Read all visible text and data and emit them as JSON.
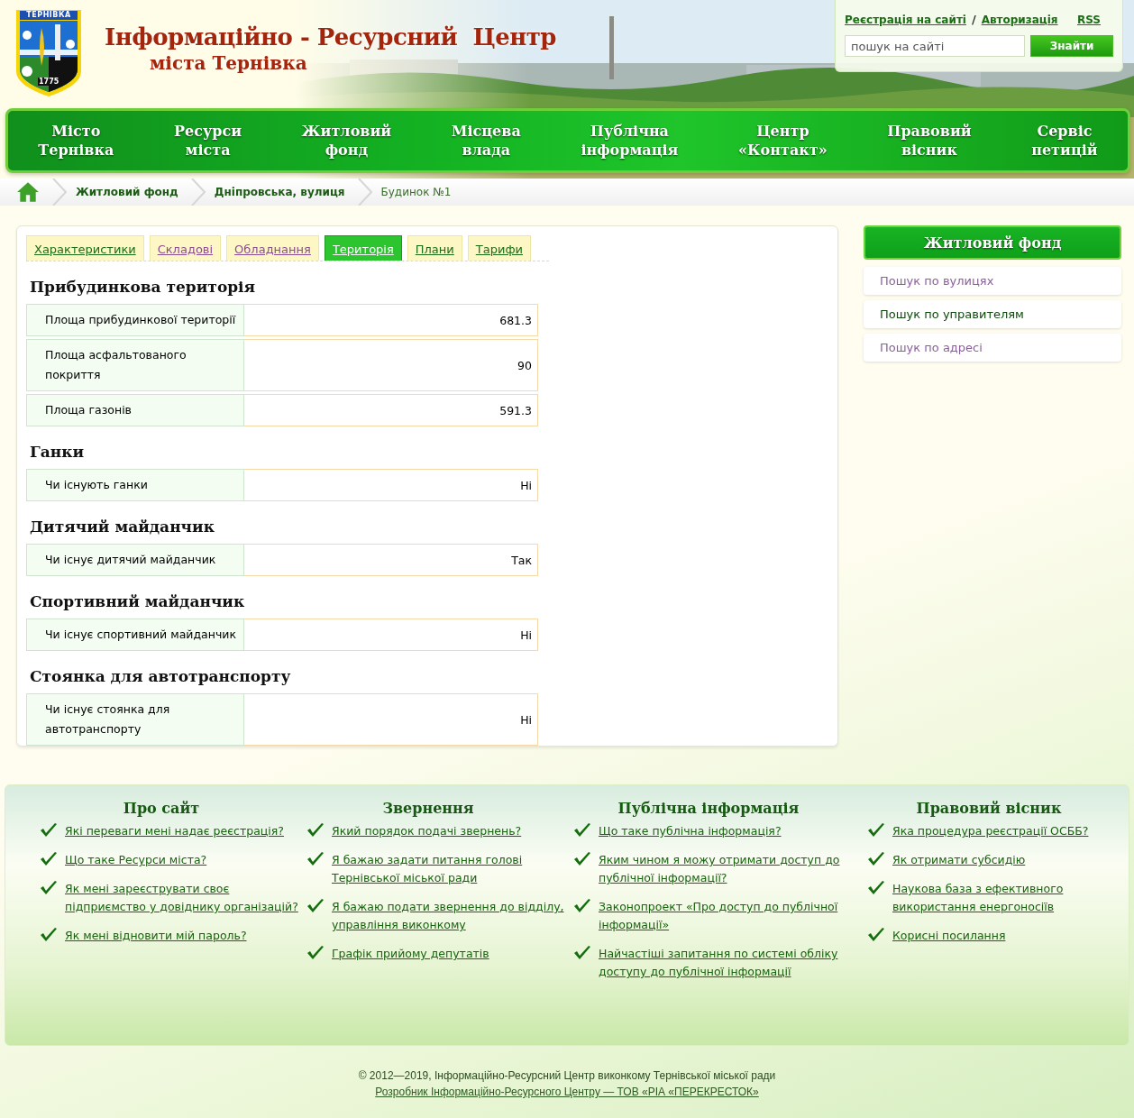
{
  "header": {
    "logo_text": "ТЕРНІВКА",
    "logo_year": "1775",
    "title": "Інформаційно - Ресурсний  Центр",
    "subtitle": "міста Тернівка",
    "auth_links": [
      "Реєстрація на сайті",
      "Авторизація"
    ],
    "auth_separator": "/",
    "rss": "RSS",
    "search": {
      "placeholder": "пошук на сайті",
      "button": "Знайти"
    }
  },
  "nav": [
    {
      "lines": [
        "Місто",
        "Тернівка"
      ]
    },
    {
      "lines": [
        "Ресурси",
        "міста"
      ]
    },
    {
      "lines": [
        "Житловий",
        "фонд"
      ]
    },
    {
      "lines": [
        "Місцева",
        "влада"
      ]
    },
    {
      "lines": [
        "Публічна",
        "інформація"
      ]
    },
    {
      "lines": [
        "Центр",
        "«Контакт»"
      ]
    },
    {
      "lines": [
        "Правовий",
        "вісник"
      ]
    },
    {
      "lines": [
        "Сервіс",
        "петицій"
      ]
    }
  ],
  "breadcrumbs": [
    {
      "label": "Житловий фонд",
      "kind": "link"
    },
    {
      "label": "Дніпровська, вулиця",
      "kind": "link"
    },
    {
      "label": "Будинок №1",
      "kind": "current"
    }
  ],
  "tabs": [
    {
      "label": "Характеристики",
      "selected": false,
      "visited": false
    },
    {
      "label": "Складові",
      "selected": false,
      "visited": true
    },
    {
      "label": "Обладнання",
      "selected": false,
      "visited": true
    },
    {
      "label": "Територія",
      "selected": true,
      "visited": false
    },
    {
      "label": "Плани",
      "selected": false,
      "visited": false
    },
    {
      "label": "Тарифи",
      "selected": false,
      "visited": false
    }
  ],
  "sections": [
    {
      "title": "Прибудинкова територія",
      "rows": [
        {
          "label": "Площа прибудинкової території",
          "value": "681.3"
        },
        {
          "label": "Площа асфальтованого покриття",
          "value": "90"
        },
        {
          "label": "Площа газонів",
          "value": "591.3"
        }
      ]
    },
    {
      "title": "Ганки",
      "rows": [
        {
          "label": "Чи існують ганки",
          "value": "Ні"
        }
      ]
    },
    {
      "title": "Дитячий майданчик",
      "rows": [
        {
          "label": "Чи існує дитячий майданчик",
          "value": "Так"
        }
      ]
    },
    {
      "title": "Спортивний майданчик",
      "rows": [
        {
          "label": "Чи існує спортивний майданчик",
          "value": "Ні"
        }
      ]
    },
    {
      "title": "Стоянка для автотранспорту",
      "rows": [
        {
          "label": "Чи існує стоянка для автотранспорту",
          "value": "Ні"
        }
      ]
    }
  ],
  "sidebar": {
    "title": "Житловий фонд",
    "items": [
      {
        "label": "Пошук по вулицях",
        "visited": true
      },
      {
        "label": "Пошук по управителям",
        "visited": false
      },
      {
        "label": "Пошук по адресі",
        "visited": true
      }
    ]
  },
  "footer_columns": [
    {
      "title": "Про сайт",
      "links": [
        "Які переваги мені надає реєстрація?",
        "Що таке Ресурси міста?",
        "Як мені зареєструвати своє підприємство у довіднику організацій?",
        "Як мені відновити мій пароль?"
      ]
    },
    {
      "title": "Звернення",
      "links": [
        "Який порядок подачі звернень?",
        "Я бажаю задати питання голові Тернівської міської ради",
        "Я бажаю подати звернення до відділу, управління виконкому",
        "Графік прийому депутатів"
      ]
    },
    {
      "title": "Публічна інформація",
      "links": [
        "Що таке публічна інформація?",
        "Яким чином я можу отримати доступ до публічної інформації?",
        "Законопроект «Про доступ до публічної інформації»",
        "Найчастіші запитання по системі обліку доступу до публічної інформації"
      ]
    },
    {
      "title": "Правовий вісник",
      "links": [
        "Яка процедура реєстрації ОСББ?",
        "Як отримати субсидію",
        "Наукова база з ефективного використання енергоносіїв",
        "Корисні посилання"
      ]
    }
  ],
  "copyright": "© 2012—2019, Інформаційно-Ресурсний Центр виконкому Тернівської міської ради",
  "developer_link": "Розробник Інформаційно-Ресурсного Центру — ТОВ «РІА «ПЕРЕКРЕСТОК»"
}
